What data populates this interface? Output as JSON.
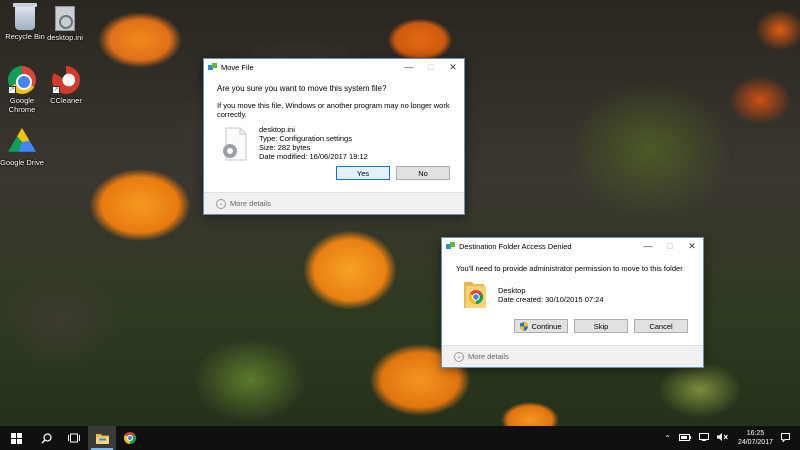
{
  "desktop": {
    "icons": [
      {
        "label": "Recycle Bin",
        "icon": "recycle-bin-icon"
      },
      {
        "label": "desktop.ini",
        "icon": "settings-file-icon"
      },
      {
        "label": "Google Chrome",
        "icon": "chrome-icon"
      },
      {
        "label": "CCleaner",
        "icon": "ccleaner-icon"
      },
      {
        "label": "Google Drive",
        "icon": "google-drive-icon"
      }
    ]
  },
  "move_dialog": {
    "title": "Move File",
    "question": "Are you sure you want to move this system file?",
    "warning": "If you move this file, Windows or another program may no longer work correctly.",
    "file_name": "desktop.ini",
    "file_type": "Type: Configuration settings",
    "file_size": "Size: 282 bytes",
    "file_modified": "Date modified: 16/06/2017 19:12",
    "yes_label": "Yes",
    "no_label": "No",
    "more_details": "More details"
  },
  "access_dialog": {
    "title": "Destination Folder Access Denied",
    "message": "You'll need to provide administrator permission to move to this folder",
    "item_name": "Desktop",
    "item_created": "Date created: 30/10/2015 07:24",
    "continue_label": "Continue",
    "skip_label": "Skip",
    "cancel_label": "Cancel",
    "more_details": "More details"
  },
  "taskbar": {
    "time": "16:25",
    "date": "24/07/2017"
  },
  "colors": {
    "accent": "#0078d7",
    "taskbar": "#101010"
  }
}
